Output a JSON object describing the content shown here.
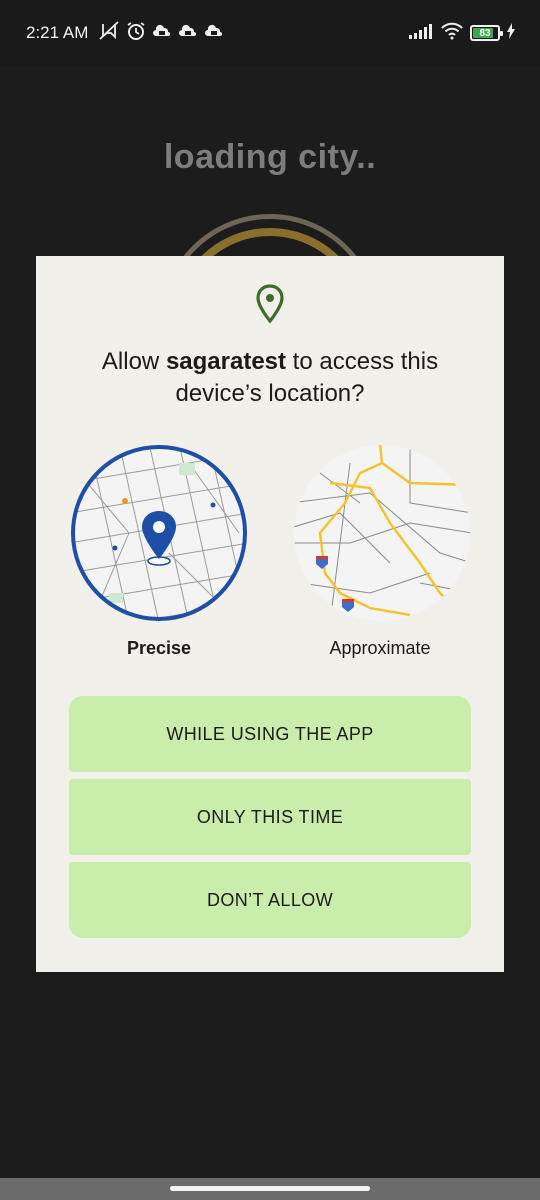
{
  "status_bar": {
    "time": "2:21 AM",
    "battery_level": "83",
    "battery_fraction": 0.83,
    "left_icons": [
      "mute-vibrate-icon",
      "alarm-icon",
      "cloud-icon",
      "cloud-icon",
      "cloud-icon"
    ],
    "right_icons": [
      "signal-icon",
      "wifi-icon",
      "battery-icon",
      "charging-icon"
    ]
  },
  "background": {
    "loading_text": "loading city.."
  },
  "dialog": {
    "icon": "location-pin-icon",
    "title_prefix": "Allow ",
    "app_name": "sagaratest",
    "title_suffix": " to access this device’s location?",
    "options": [
      {
        "label": "Precise",
        "selected": true
      },
      {
        "label": "Approximate",
        "selected": false
      }
    ],
    "buttons": [
      {
        "label": "WHILE USING THE APP"
      },
      {
        "label": "ONLY THIS TIME"
      },
      {
        "label": "DON’T ALLOW"
      }
    ]
  },
  "colors": {
    "dialog_background": "#f2f0eb",
    "button_background": "#c9edaa",
    "pin_color": "#3f6b2a",
    "precise_ring": "#1d4fa6",
    "road_yellow": "#f5c22b"
  }
}
